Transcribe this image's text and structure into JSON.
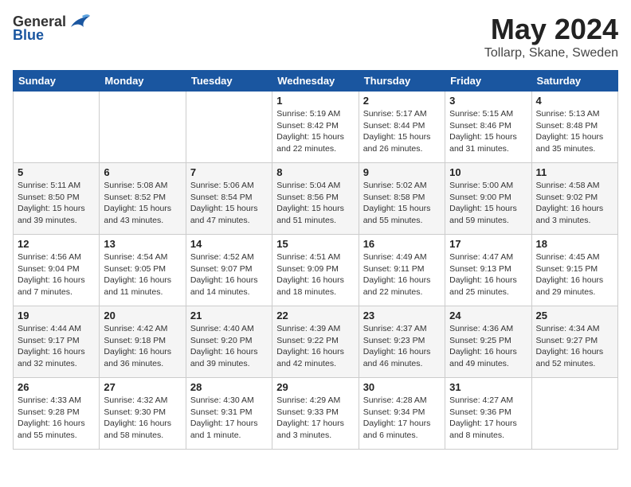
{
  "header": {
    "logo": {
      "general": "General",
      "blue": "Blue"
    },
    "title": "May 2024",
    "location": "Tollarp, Skane, Sweden"
  },
  "calendar": {
    "columns": [
      "Sunday",
      "Monday",
      "Tuesday",
      "Wednesday",
      "Thursday",
      "Friday",
      "Saturday"
    ],
    "weeks": [
      [
        {
          "day": "",
          "info": ""
        },
        {
          "day": "",
          "info": ""
        },
        {
          "day": "",
          "info": ""
        },
        {
          "day": "1",
          "info": "Sunrise: 5:19 AM\nSunset: 8:42 PM\nDaylight: 15 hours\nand 22 minutes."
        },
        {
          "day": "2",
          "info": "Sunrise: 5:17 AM\nSunset: 8:44 PM\nDaylight: 15 hours\nand 26 minutes."
        },
        {
          "day": "3",
          "info": "Sunrise: 5:15 AM\nSunset: 8:46 PM\nDaylight: 15 hours\nand 31 minutes."
        },
        {
          "day": "4",
          "info": "Sunrise: 5:13 AM\nSunset: 8:48 PM\nDaylight: 15 hours\nand 35 minutes."
        }
      ],
      [
        {
          "day": "5",
          "info": "Sunrise: 5:11 AM\nSunset: 8:50 PM\nDaylight: 15 hours\nand 39 minutes."
        },
        {
          "day": "6",
          "info": "Sunrise: 5:08 AM\nSunset: 8:52 PM\nDaylight: 15 hours\nand 43 minutes."
        },
        {
          "day": "7",
          "info": "Sunrise: 5:06 AM\nSunset: 8:54 PM\nDaylight: 15 hours\nand 47 minutes."
        },
        {
          "day": "8",
          "info": "Sunrise: 5:04 AM\nSunset: 8:56 PM\nDaylight: 15 hours\nand 51 minutes."
        },
        {
          "day": "9",
          "info": "Sunrise: 5:02 AM\nSunset: 8:58 PM\nDaylight: 15 hours\nand 55 minutes."
        },
        {
          "day": "10",
          "info": "Sunrise: 5:00 AM\nSunset: 9:00 PM\nDaylight: 15 hours\nand 59 minutes."
        },
        {
          "day": "11",
          "info": "Sunrise: 4:58 AM\nSunset: 9:02 PM\nDaylight: 16 hours\nand 3 minutes."
        }
      ],
      [
        {
          "day": "12",
          "info": "Sunrise: 4:56 AM\nSunset: 9:04 PM\nDaylight: 16 hours\nand 7 minutes."
        },
        {
          "day": "13",
          "info": "Sunrise: 4:54 AM\nSunset: 9:05 PM\nDaylight: 16 hours\nand 11 minutes."
        },
        {
          "day": "14",
          "info": "Sunrise: 4:52 AM\nSunset: 9:07 PM\nDaylight: 16 hours\nand 14 minutes."
        },
        {
          "day": "15",
          "info": "Sunrise: 4:51 AM\nSunset: 9:09 PM\nDaylight: 16 hours\nand 18 minutes."
        },
        {
          "day": "16",
          "info": "Sunrise: 4:49 AM\nSunset: 9:11 PM\nDaylight: 16 hours\nand 22 minutes."
        },
        {
          "day": "17",
          "info": "Sunrise: 4:47 AM\nSunset: 9:13 PM\nDaylight: 16 hours\nand 25 minutes."
        },
        {
          "day": "18",
          "info": "Sunrise: 4:45 AM\nSunset: 9:15 PM\nDaylight: 16 hours\nand 29 minutes."
        }
      ],
      [
        {
          "day": "19",
          "info": "Sunrise: 4:44 AM\nSunset: 9:17 PM\nDaylight: 16 hours\nand 32 minutes."
        },
        {
          "day": "20",
          "info": "Sunrise: 4:42 AM\nSunset: 9:18 PM\nDaylight: 16 hours\nand 36 minutes."
        },
        {
          "day": "21",
          "info": "Sunrise: 4:40 AM\nSunset: 9:20 PM\nDaylight: 16 hours\nand 39 minutes."
        },
        {
          "day": "22",
          "info": "Sunrise: 4:39 AM\nSunset: 9:22 PM\nDaylight: 16 hours\nand 42 minutes."
        },
        {
          "day": "23",
          "info": "Sunrise: 4:37 AM\nSunset: 9:23 PM\nDaylight: 16 hours\nand 46 minutes."
        },
        {
          "day": "24",
          "info": "Sunrise: 4:36 AM\nSunset: 9:25 PM\nDaylight: 16 hours\nand 49 minutes."
        },
        {
          "day": "25",
          "info": "Sunrise: 4:34 AM\nSunset: 9:27 PM\nDaylight: 16 hours\nand 52 minutes."
        }
      ],
      [
        {
          "day": "26",
          "info": "Sunrise: 4:33 AM\nSunset: 9:28 PM\nDaylight: 16 hours\nand 55 minutes."
        },
        {
          "day": "27",
          "info": "Sunrise: 4:32 AM\nSunset: 9:30 PM\nDaylight: 16 hours\nand 58 minutes."
        },
        {
          "day": "28",
          "info": "Sunrise: 4:30 AM\nSunset: 9:31 PM\nDaylight: 17 hours\nand 1 minute."
        },
        {
          "day": "29",
          "info": "Sunrise: 4:29 AM\nSunset: 9:33 PM\nDaylight: 17 hours\nand 3 minutes."
        },
        {
          "day": "30",
          "info": "Sunrise: 4:28 AM\nSunset: 9:34 PM\nDaylight: 17 hours\nand 6 minutes."
        },
        {
          "day": "31",
          "info": "Sunrise: 4:27 AM\nSunset: 9:36 PM\nDaylight: 17 hours\nand 8 minutes."
        },
        {
          "day": "",
          "info": ""
        }
      ]
    ]
  }
}
